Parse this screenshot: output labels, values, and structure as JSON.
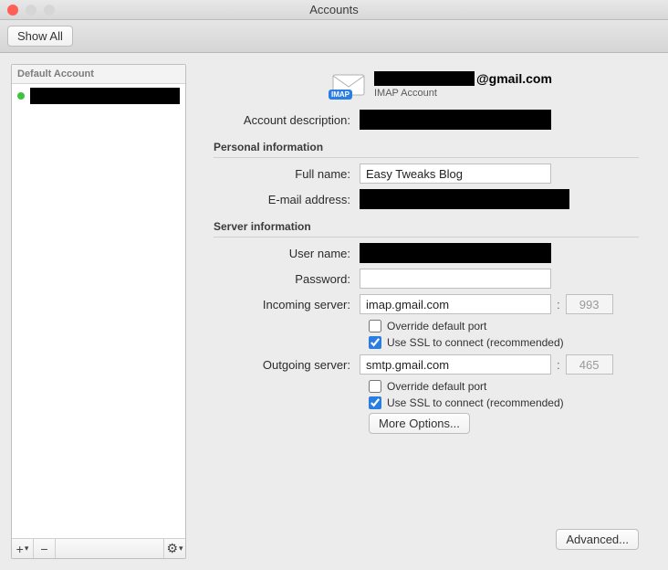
{
  "window": {
    "title": "Accounts"
  },
  "toolbar": {
    "show_all": "Show All"
  },
  "sidebar": {
    "header": "Default Account",
    "items": [
      {
        "label": ""
      }
    ],
    "footer": {
      "add": "+",
      "dropdown": "▾",
      "remove": "−",
      "gear": "⚙︎"
    }
  },
  "account": {
    "email_suffix": "@gmail.com",
    "type_label": "IMAP Account",
    "imap_badge": "IMAP"
  },
  "labels": {
    "description": "Account description:",
    "personal_section": "Personal information",
    "full_name": "Full name:",
    "email": "E-mail address:",
    "server_section": "Server information",
    "user_name": "User name:",
    "password": "Password:",
    "incoming": "Incoming server:",
    "outgoing": "Outgoing server:",
    "override_port": "Override default port",
    "use_ssl": "Use SSL to connect (recommended)",
    "more_options": "More Options...",
    "advanced": "Advanced..."
  },
  "values": {
    "description": "",
    "full_name": "Easy Tweaks Blog",
    "email": "",
    "user_name": "",
    "password": "",
    "incoming_server": "imap.gmail.com",
    "incoming_port": "993",
    "incoming_override": false,
    "incoming_ssl": true,
    "outgoing_server": "smtp.gmail.com",
    "outgoing_port": "465",
    "outgoing_override": false,
    "outgoing_ssl": true
  }
}
